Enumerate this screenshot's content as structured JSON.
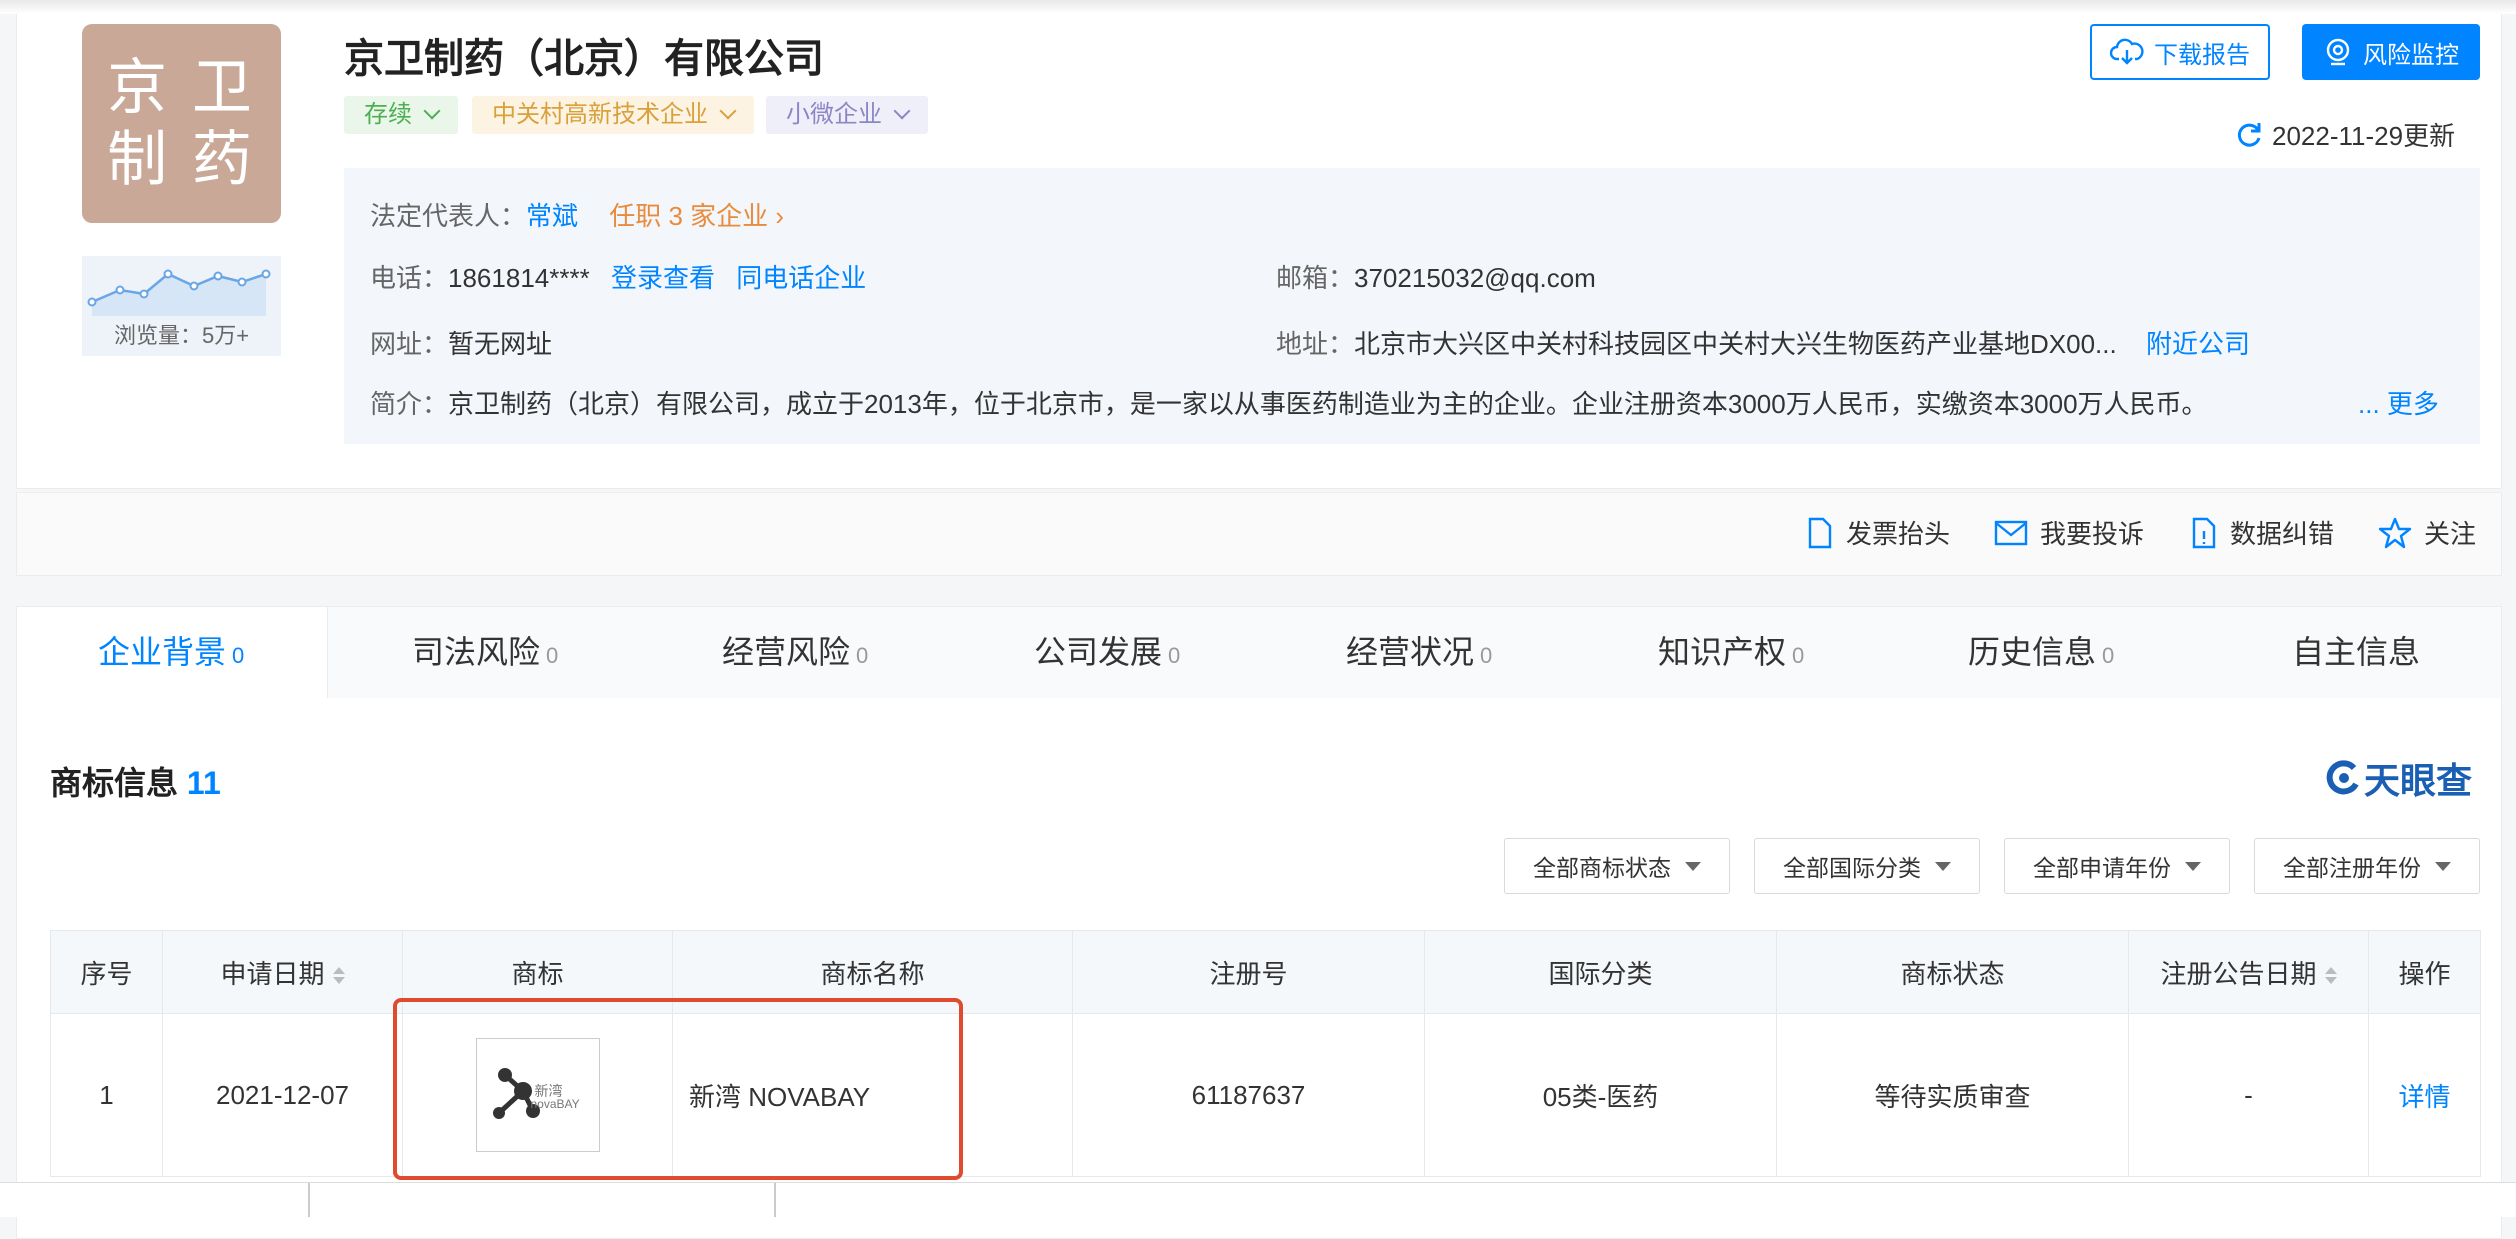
{
  "company": {
    "logo_line1": "京 卫",
    "logo_line2": "制 药",
    "name": "京卫制药（北京）有限公司",
    "views": "浏览量：5万+",
    "tags": [
      "存续",
      "中关村高新技术企业",
      "小微企业"
    ],
    "update": "2022-11-29更新"
  },
  "buttons": {
    "download": "下载报告",
    "monitor": "风险监控"
  },
  "info": {
    "rep_label": "法定代表人：",
    "rep_name": "常斌",
    "rep_jobs": "任职 3 家企业",
    "phone_label": "电话：",
    "phone": "1861814****",
    "phone_login": "登录查看",
    "phone_same": "同电话企业",
    "email_label": "邮箱：",
    "email": "370215032@qq.com",
    "site_label": "网址：",
    "site": "暂无网址",
    "addr_label": "地址：",
    "addr": "北京市大兴区中关村科技园区中关村大兴生物医药产业基地DX00...",
    "addr_near": "附近公司",
    "intro_label": "简介：",
    "intro": "京卫制药（北京）有限公司，成立于2013年，位于北京市，是一家以从事医药制造业为主的企业。企业注册资本3000万人民币，实缴资本3000万人民币。",
    "intro_more": "... 更多"
  },
  "actions": [
    "发票抬头",
    "我要投诉",
    "数据纠错",
    "关注"
  ],
  "tabs": [
    {
      "label": "企业背景",
      "count": "0"
    },
    {
      "label": "司法风险",
      "count": "0"
    },
    {
      "label": "经营风险",
      "count": "0"
    },
    {
      "label": "公司发展",
      "count": "0"
    },
    {
      "label": "经营状况",
      "count": "0"
    },
    {
      "label": "知识产权",
      "count": "0"
    },
    {
      "label": "历史信息",
      "count": "0"
    },
    {
      "label": "自主信息",
      "count": ""
    }
  ],
  "trademark": {
    "title": "商标信息",
    "count": "11",
    "brand": "天眼查",
    "filters": [
      "全部商标状态",
      "全部国际分类",
      "全部申请年份",
      "全部注册年份"
    ],
    "columns": [
      "序号",
      "申请日期",
      "商标",
      "商标名称",
      "注册号",
      "国际分类",
      "商标状态",
      "注册公告日期",
      "操作"
    ],
    "rows": [
      {
        "index": "1",
        "date": "2021-12-07",
        "logo_cn": "新湾",
        "logo_en": "novaBAY",
        "name": "新湾 NOVABAY",
        "reg_no": "61187637",
        "class": "05类-医药",
        "status": "等待实质审查",
        "pub_date": "-",
        "action": "详情"
      }
    ]
  },
  "colors": {
    "accent": "#0084ff",
    "highlight": "#e04a2f",
    "logo_bg": "#c9a898",
    "tag_green": "#4caf50",
    "tag_orange": "#d9a13b",
    "tag_purple": "#8c86c6"
  }
}
